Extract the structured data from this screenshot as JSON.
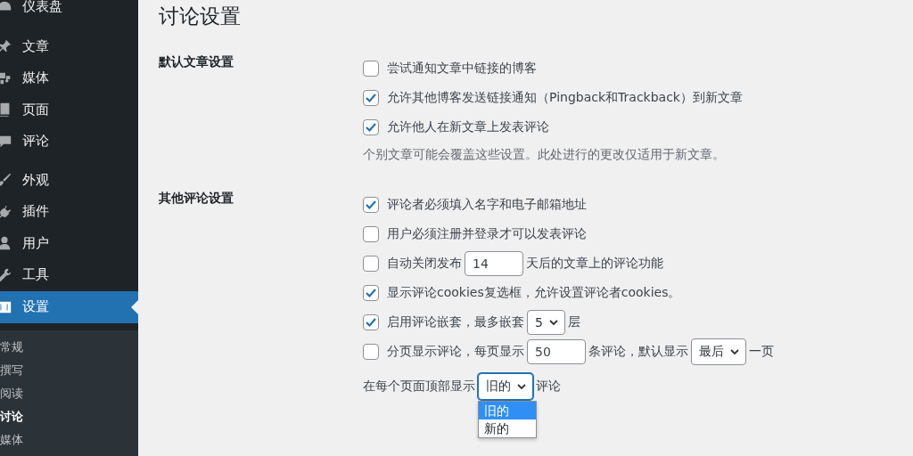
{
  "sidebar": {
    "groups": [
      [
        {
          "label": "仪表盘",
          "selected": false
        }
      ],
      [
        {
          "label": "文章",
          "selected": false
        },
        {
          "label": "媒体",
          "selected": false
        },
        {
          "label": "页面",
          "selected": false
        },
        {
          "label": "评论",
          "selected": false
        }
      ],
      [
        {
          "label": "外观",
          "selected": false
        },
        {
          "label": "插件",
          "selected": false
        },
        {
          "label": "用户",
          "selected": false
        },
        {
          "label": "工具",
          "selected": false
        },
        {
          "label": "设置",
          "selected": true
        }
      ]
    ],
    "submenu": [
      {
        "label": "常规",
        "selected": false
      },
      {
        "label": "撰写",
        "selected": false
      },
      {
        "label": "阅读",
        "selected": false
      },
      {
        "label": "讨论",
        "selected": true
      },
      {
        "label": "媒体",
        "selected": false
      }
    ]
  },
  "page_title": "讨论设置",
  "sections": [
    {
      "label": "默认文章设置",
      "options": [
        {
          "checked": false,
          "parts": [
            {
              "kind": "text",
              "text": "尝试通知文章中链接的博客"
            }
          ]
        },
        {
          "checked": true,
          "parts": [
            {
              "kind": "text",
              "text": "允许其他博客发送链接通知（Pingback和Trackback）到新文章"
            }
          ]
        },
        {
          "checked": true,
          "parts": [
            {
              "kind": "text",
              "text": "允许他人在新文章上发表评论"
            }
          ]
        }
      ],
      "description": "个别文章可能会覆盖这些设置。此处进行的更改仅适用于新文章。"
    },
    {
      "label": "其他评论设置",
      "options": [
        {
          "checked": true,
          "parts": [
            {
              "kind": "text",
              "text": "评论者必须填入名字和电子邮箱地址"
            }
          ]
        },
        {
          "checked": false,
          "parts": [
            {
              "kind": "text",
              "text": "用户必须注册并登录才可以发表评论"
            }
          ]
        },
        {
          "checked": false,
          "parts": [
            {
              "kind": "text",
              "text": "自动关闭发布"
            },
            {
              "kind": "input",
              "value": "14"
            },
            {
              "kind": "text",
              "text": "天后的文章上的评论功能"
            }
          ]
        },
        {
          "checked": true,
          "parts": [
            {
              "kind": "text",
              "text": "显示评论cookies复选框，允许设置评论者cookies。"
            }
          ]
        },
        {
          "checked": true,
          "parts": [
            {
              "kind": "text",
              "text": "启用评论嵌套，最多嵌套"
            },
            {
              "kind": "select",
              "value": "5"
            },
            {
              "kind": "text",
              "text": "层"
            }
          ]
        },
        {
          "checked": false,
          "parts": [
            {
              "kind": "text",
              "text": "分页显示评论，每页显示"
            },
            {
              "kind": "input",
              "value": "50"
            },
            {
              "kind": "text",
              "text": "条评论，默认显示"
            },
            {
              "kind": "select",
              "value": "最后"
            },
            {
              "kind": "text",
              "text": "一页"
            }
          ]
        }
      ],
      "plain_rows": [
        {
          "parts": [
            {
              "kind": "text",
              "text": "在每个页面顶部显示"
            },
            {
              "kind": "select",
              "value": "旧的",
              "open": true,
              "options": [
                {
                  "label": "旧的",
                  "selected": true
                },
                {
                  "label": "新的",
                  "selected": false
                }
              ]
            },
            {
              "kind": "text",
              "text": "评论"
            }
          ]
        }
      ]
    }
  ]
}
